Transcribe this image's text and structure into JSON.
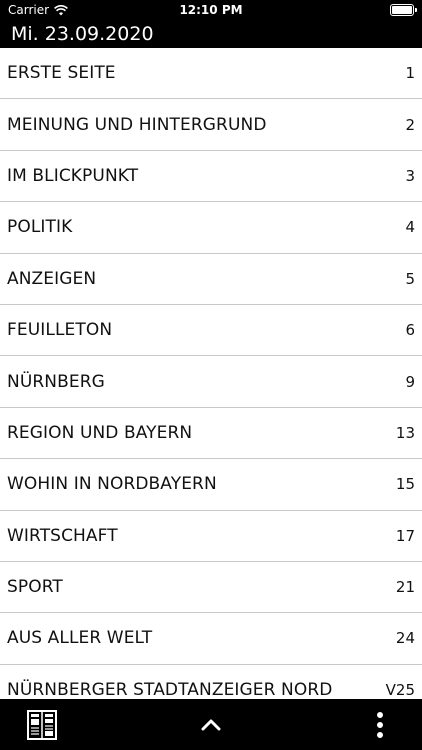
{
  "status": {
    "carrier": "Carrier",
    "time": "12:10 PM",
    "battery_level": 1.0
  },
  "header": {
    "date": "Mi. 23.09.2020"
  },
  "sections": [
    {
      "label": "ERSTE SEITE",
      "page": "1"
    },
    {
      "label": "MEINUNG UND HINTERGRUND",
      "page": "2"
    },
    {
      "label": "IM BLICKPUNKT",
      "page": "3"
    },
    {
      "label": "POLITIK",
      "page": "4"
    },
    {
      "label": "ANZEIGEN",
      "page": "5"
    },
    {
      "label": "FEUILLETON",
      "page": "6"
    },
    {
      "label": "NÜRNBERG",
      "page": "9"
    },
    {
      "label": "REGION UND BAYERN",
      "page": "13"
    },
    {
      "label": "WOHIN IN NORDBAYERN",
      "page": "15"
    },
    {
      "label": "WIRTSCHAFT",
      "page": "17"
    },
    {
      "label": "SPORT",
      "page": "21"
    },
    {
      "label": "AUS ALLER WELT",
      "page": "24"
    },
    {
      "label": "NÜRNBERGER STADTANZEIGER NORD",
      "page": "V25"
    }
  ],
  "toolbar": {
    "left_icon": "newspaper-pages-icon",
    "center_icon": "chevron-up-icon",
    "right_icon": "more-vertical-icon"
  }
}
